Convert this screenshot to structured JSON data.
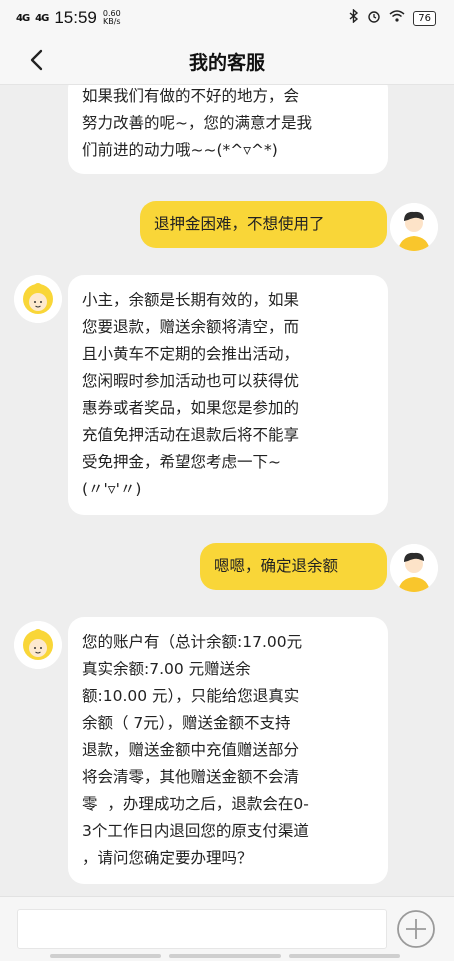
{
  "status_bar": {
    "signal1": "4G",
    "signal2": "4G",
    "time": "15:59",
    "speed_value": "0.60",
    "speed_unit": "KB/s",
    "battery": "76"
  },
  "header": {
    "title": "我的客服",
    "back_icon": "chevron-left-icon"
  },
  "messages": [
    {
      "from": "bot",
      "text": "如果我们有做的不好的地方，会\n努力改善的呢~，您的满意才是我\n们前进的动力哦~~(*^▿^*)"
    },
    {
      "from": "user",
      "text": "退押金困难，不想使用了"
    },
    {
      "from": "bot",
      "text": "小主，余额是长期有效的，如果\n您要退款，赠送余额将清空，而\n且小黄车不定期的会推出活动，\n您闲暇时参加活动也可以获得优\n惠券或者奖品，如果您是参加的\n充值免押活动在退款后将不能享\n受免押金，希望您考虑一下~\n(〃'▿'〃)"
    },
    {
      "from": "user",
      "text": "嗯嗯，确定退余额"
    },
    {
      "from": "bot",
      "text": "您的账户有（总计余额:17.00元\n真实余额:7.00 元赠送余\n额:10.00 元），只能给您退真实\n余额（ 7元），赠送金额不支持\n退款，赠送金额中充值赠送部分\n将会清零，其他赠送金额不会清\n零  ，办理成功之后，退款会在0-\n3个工作日内退回您的原支付渠道\n，请问您确定要办理吗？"
    }
  ],
  "input": {
    "value": "",
    "placeholder": ""
  },
  "colors": {
    "user_bubble": "#f9d638",
    "bot_bubble": "#ffffff",
    "background": "#eeeeee"
  },
  "icons": {
    "bot_avatar": "customer-service-avatar-icon",
    "user_avatar": "user-avatar-icon",
    "plus": "plus-circle-icon"
  }
}
